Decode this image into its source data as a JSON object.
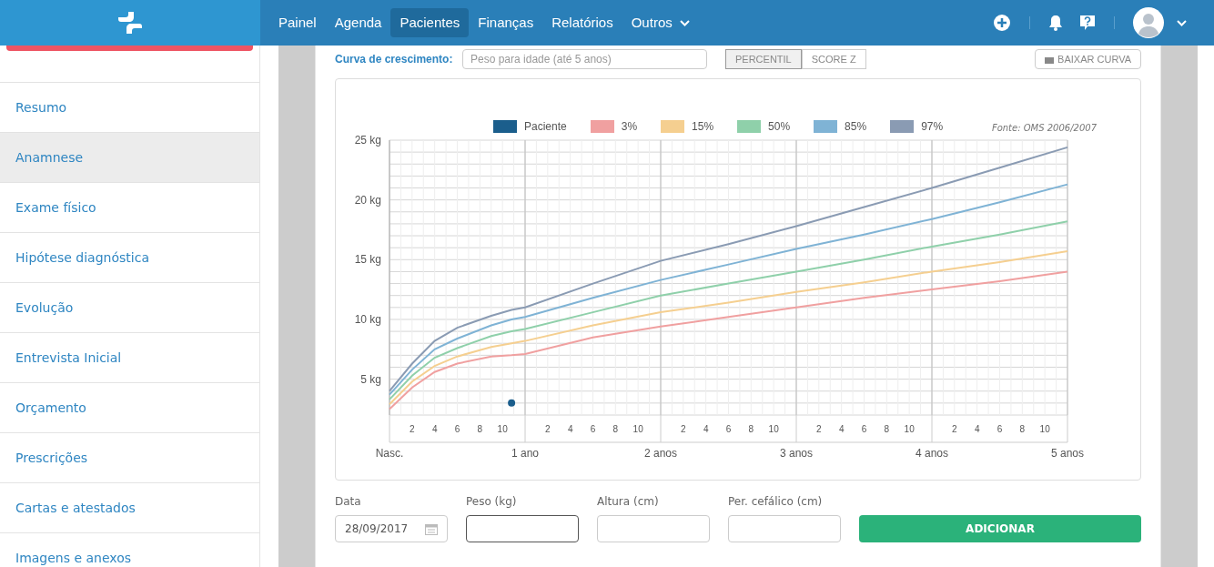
{
  "navbar": {
    "nav_items": [
      {
        "label": "Painel",
        "selected": false,
        "dropdown": false
      },
      {
        "label": "Agenda",
        "selected": false,
        "dropdown": false
      },
      {
        "label": "Pacientes",
        "selected": true,
        "dropdown": false
      },
      {
        "label": "Finanças",
        "selected": false,
        "dropdown": false
      },
      {
        "label": "Relatórios",
        "selected": false,
        "dropdown": false
      },
      {
        "label": "Outros",
        "selected": false,
        "dropdown": true
      }
    ]
  },
  "sidebar": {
    "items": [
      {
        "label": "Resumo",
        "selected": false
      },
      {
        "label": "Anamnese",
        "selected": true
      },
      {
        "label": "Exame físico",
        "selected": false
      },
      {
        "label": "Hipótese diagnóstica",
        "selected": false
      },
      {
        "label": "Evolução",
        "selected": false
      },
      {
        "label": "Entrevista Inicial",
        "selected": false
      },
      {
        "label": "Orçamento",
        "selected": false
      },
      {
        "label": "Prescrições",
        "selected": false
      },
      {
        "label": "Cartas e atestados",
        "selected": false
      },
      {
        "label": "Imagens e anexos",
        "selected": false
      }
    ]
  },
  "curve_controls": {
    "label": "Curva de crescimento:",
    "select_value": "Peso para idade (até 5 anos)",
    "modes": [
      {
        "label": "PERCENTIL",
        "selected": true
      },
      {
        "label": "SCORE Z",
        "selected": false
      }
    ],
    "download_button": "BAIXAR CURVA"
  },
  "growth_chart": {
    "source_note": "Fonte: OMS 2006/2007",
    "month_labels": [
      "2",
      "4",
      "6",
      "8",
      "10",
      "2",
      "4",
      "6",
      "8",
      "10",
      "2",
      "4",
      "6",
      "8",
      "10",
      "2",
      "4",
      "6",
      "8",
      "10",
      "2",
      "4",
      "6",
      "8",
      "10"
    ],
    "chart_data": {
      "type": "line",
      "grid": true,
      "legend": true,
      "x": [
        0,
        0.167,
        0.333,
        0.5,
        0.75,
        0.9,
        1,
        1.5,
        2,
        2.5,
        3,
        3.5,
        4,
        4.5,
        5
      ],
      "xlim": [
        0,
        5
      ],
      "ylim": [
        2,
        25
      ],
      "yticks": [
        {
          "value": 5,
          "label": "5 kg"
        },
        {
          "value": 10,
          "label": "10 kg"
        },
        {
          "value": 15,
          "label": "15 kg"
        },
        {
          "value": 20,
          "label": "20 kg"
        },
        {
          "value": 25,
          "label": "25 kg"
        }
      ],
      "xticks": [
        {
          "value": 0,
          "label": "Nasc."
        },
        {
          "value": 1,
          "label": "1 ano"
        },
        {
          "value": 2,
          "label": "2 anos"
        },
        {
          "value": 3,
          "label": "3 anos"
        },
        {
          "value": 4,
          "label": "4 anos"
        },
        {
          "value": 5,
          "label": "5 anos"
        }
      ],
      "series": [
        {
          "name": "Paciente",
          "color": "#1b5e8c",
          "marker": "circle",
          "values": [
            null,
            null,
            null,
            null,
            null,
            3.0,
            null,
            null,
            null,
            null,
            null,
            null,
            null,
            null,
            null
          ]
        },
        {
          "name": "3%",
          "color": "#f0a0a0",
          "values": [
            2.5,
            4.3,
            5.6,
            6.3,
            6.9,
            7.0,
            7.1,
            8.5,
            9.4,
            10.2,
            11.0,
            11.8,
            12.5,
            13.2,
            14.0
          ]
        },
        {
          "name": "15%",
          "color": "#f5cf90",
          "values": [
            2.9,
            4.8,
            6.1,
            6.9,
            7.7,
            8.0,
            8.2,
            9.5,
            10.6,
            11.4,
            12.3,
            13.1,
            14.0,
            14.8,
            15.7
          ]
        },
        {
          "name": "50%",
          "color": "#8fd0aa",
          "values": [
            3.3,
            5.3,
            6.8,
            7.6,
            8.6,
            9.0,
            9.2,
            10.6,
            12.0,
            13.0,
            14.0,
            15.0,
            16.1,
            17.1,
            18.2
          ]
        },
        {
          "name": "85%",
          "color": "#7fb3d5",
          "values": [
            3.7,
            5.8,
            7.5,
            8.4,
            9.5,
            10.0,
            10.2,
            11.8,
            13.3,
            14.6,
            15.9,
            17.1,
            18.4,
            19.8,
            21.3
          ]
        },
        {
          "name": "97%",
          "color": "#8a9bb3",
          "values": [
            4.0,
            6.3,
            8.2,
            9.3,
            10.3,
            10.8,
            11.0,
            13.0,
            14.9,
            16.3,
            17.8,
            19.4,
            21.0,
            22.7,
            24.4
          ]
        }
      ]
    }
  },
  "entry_form": {
    "fields": [
      {
        "label": "Data",
        "value": "28/09/2017",
        "kind": "date",
        "focused": false
      },
      {
        "label": "Peso (kg)",
        "kind": "text",
        "focused": true
      },
      {
        "label": "Altura (cm)",
        "kind": "text",
        "focused": false
      },
      {
        "label": "Per. cefálico (cm)",
        "kind": "text",
        "focused": false
      }
    ],
    "submit_button": "ADICIONAR"
  }
}
